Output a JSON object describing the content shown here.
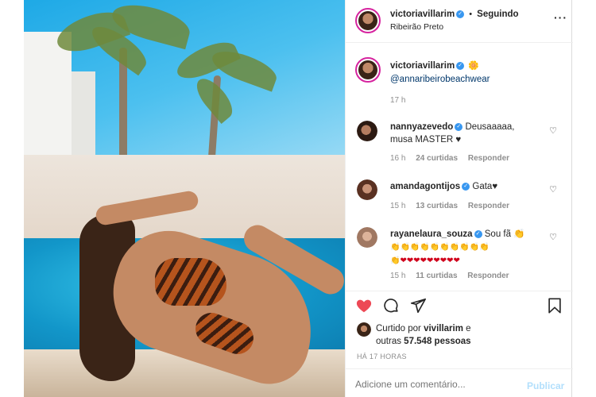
{
  "header": {
    "username": "victoriavillarim",
    "separator": "•",
    "follow_status": "Seguindo",
    "location": "Ribeirão Preto",
    "more_icon": "ellipsis-icon"
  },
  "caption": {
    "username": "victoriavillarim",
    "emoji": "🌼",
    "mention": "@annaribeirobeachwear",
    "time": "17 h"
  },
  "comments": [
    {
      "username": "nannyazevedo",
      "text": "Deusaaaaa, musa MASTER ♥",
      "text_line1": "Deusaaaaa,",
      "text_line2": "musa MASTER ♥",
      "time": "16 h",
      "likes": "24 curtidas",
      "reply": "Responder"
    },
    {
      "username": "amandagontijos",
      "text": "Gata♥",
      "time": "15 h",
      "likes": "13 curtidas",
      "reply": "Responder"
    },
    {
      "username": "rayanelaura_souza",
      "text": "Sou fã 👏",
      "text_line1": "Sou fã 👏",
      "text_line2": "👏👏👏👏👏👏👏👏👏👏",
      "text_line3": "👏❤❤❤❤❤❤❤❤❤",
      "time": "15 h",
      "likes": "11 curtidas",
      "reply": "Responder"
    }
  ],
  "actions": {
    "like_icon": "heart-filled-icon",
    "comment_icon": "comment-icon",
    "share_icon": "paper-plane-icon",
    "save_icon": "bookmark-icon",
    "like_color": "#ed4956"
  },
  "likes": {
    "prefix": "Curtido por",
    "user": "vivillarim",
    "and": "e",
    "others_prefix": "outras",
    "count": "57.548 pessoas"
  },
  "timestamp": "HÁ 17 HORAS",
  "add_comment": {
    "placeholder": "Adicione um comentário...",
    "publish": "Publicar"
  }
}
